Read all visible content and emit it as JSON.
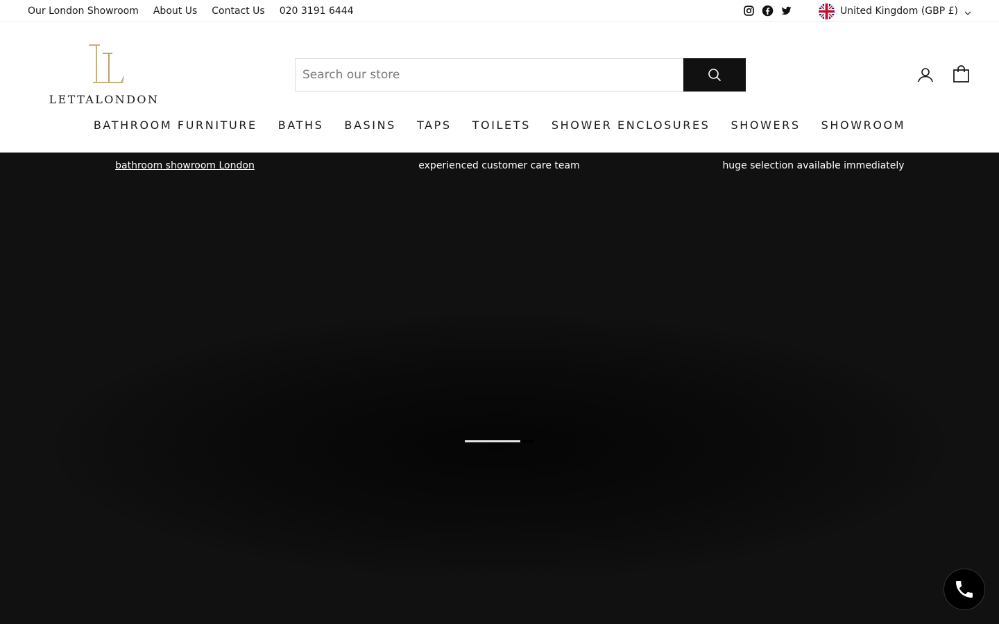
{
  "topbar": {
    "links": [
      "Our London Showroom",
      "About Us",
      "Contact Us",
      "020 3191 6444"
    ],
    "social_icons": [
      "instagram-icon",
      "facebook-icon",
      "twitter-icon"
    ],
    "region": {
      "flag_icon": "uk-flag-icon",
      "label": "United Kingdom (GBP £)"
    }
  },
  "header": {
    "logo_text": "LETTALONDON",
    "logo_color": "#c7b07a",
    "search": {
      "placeholder": "Search our store"
    },
    "icons": [
      "account-icon",
      "cart-icon"
    ]
  },
  "nav": {
    "items": [
      "BATHROOM FURNITURE",
      "BATHS",
      "BASINS",
      "TAPS",
      "TOILETS",
      "SHOWER ENCLOSURES",
      "SHOWERS",
      "SHOWROOM"
    ]
  },
  "promo": {
    "items": [
      "bathroom showroom London",
      "experienced customer care team",
      "huge selection available immediately"
    ]
  },
  "hero": {
    "loading_progress": 0.8
  },
  "call_button": {
    "icon": "phone-icon"
  },
  "colors": {
    "dark": "#111111",
    "gold": "#c7b07a",
    "white": "#ffffff"
  }
}
